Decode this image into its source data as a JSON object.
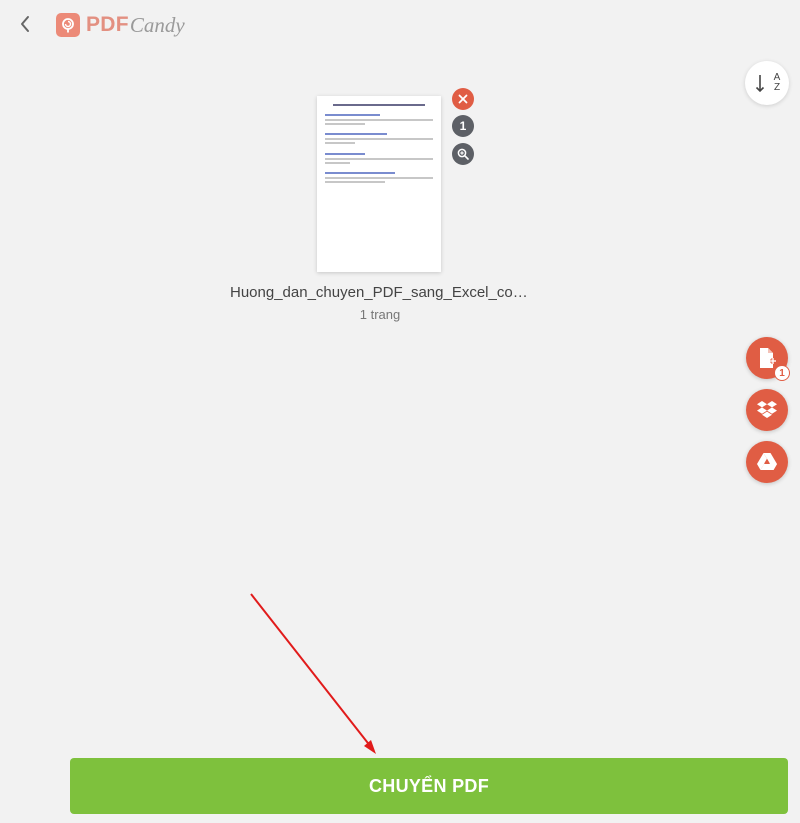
{
  "header": {
    "logo_pdf": "PDF",
    "logo_candy": "Candy"
  },
  "file": {
    "name": "Huong_dan_chuyen_PDF_sang_Excel_compr...",
    "page_count": "1 trang",
    "badge_number": "1"
  },
  "sidebar": {
    "add_file_count": "1"
  },
  "sort": {
    "label_top": "A",
    "label_bottom": "Z"
  },
  "convert": {
    "label": "CHUYỂN PDF"
  },
  "colors": {
    "accent": "#e05d44",
    "primary_button": "#7ec13d",
    "background": "#f2f2f2"
  },
  "icons": [
    "back-chevron-icon",
    "pdfcandy-logo-icon",
    "sort-az-icon",
    "close-icon",
    "zoom-in-icon",
    "add-file-icon",
    "dropbox-icon",
    "google-drive-icon"
  ]
}
